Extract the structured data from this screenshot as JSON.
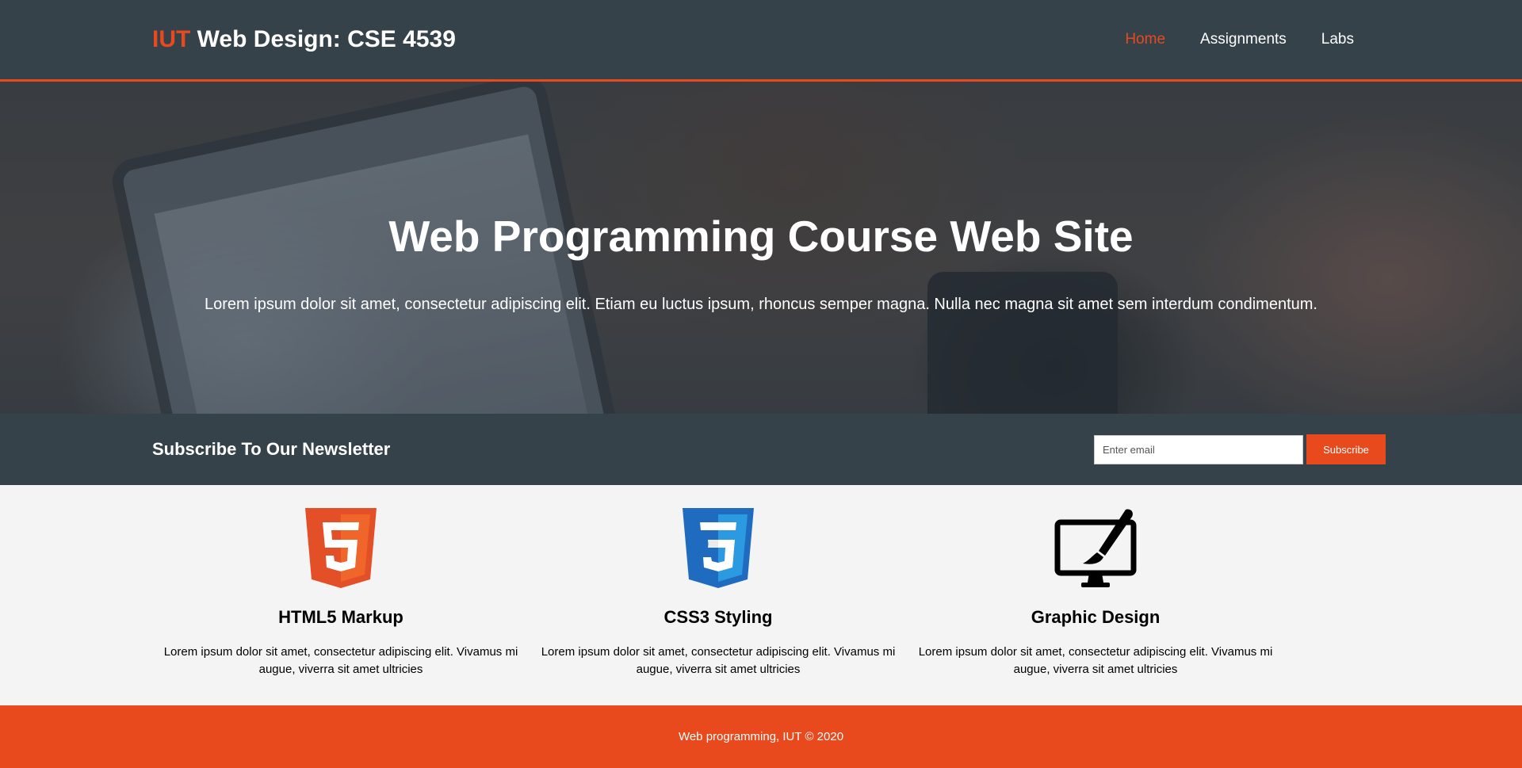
{
  "header": {
    "brand_highlight": "IUT",
    "brand_rest": " Web Design: CSE 4539",
    "nav": [
      {
        "label": "Home"
      },
      {
        "label": "Assignments"
      },
      {
        "label": "Labs"
      }
    ]
  },
  "showcase": {
    "title": "Web Programming Course Web Site",
    "text": "Lorem ipsum dolor sit amet, consectetur adipiscing elit. Etiam eu luctus ipsum, rhoncus semper magna. Nulla nec magna sit amet sem interdum condimentum."
  },
  "newsletter": {
    "title": "Subscribe To Our Newsletter",
    "email_placeholder": "Enter email",
    "button_label": "Subscribe"
  },
  "boxes": [
    {
      "icon": "html5-logo-icon",
      "title": "HTML5 Markup",
      "text": "Lorem ipsum dolor sit amet, consectetur adipiscing elit. Vivamus mi augue, viverra sit amet ultricies"
    },
    {
      "icon": "css3-logo-icon",
      "title": "CSS3 Styling",
      "text": "Lorem ipsum dolor sit amet, consectetur adipiscing elit. Vivamus mi augue, viverra sit amet ultricies"
    },
    {
      "icon": "monitor-brush-icon",
      "title": "Graphic Design",
      "text": "Lorem ipsum dolor sit amet, consectetur adipiscing elit. Vivamus mi augue, viverra sit amet ultricies"
    }
  ],
  "footer": {
    "text": "Web programming, IUT © 2020"
  },
  "colors": {
    "accent": "#e8491d",
    "dark": "#35424a",
    "light_bg": "#f4f4f4",
    "css3_blue": "#1f6bbf"
  }
}
